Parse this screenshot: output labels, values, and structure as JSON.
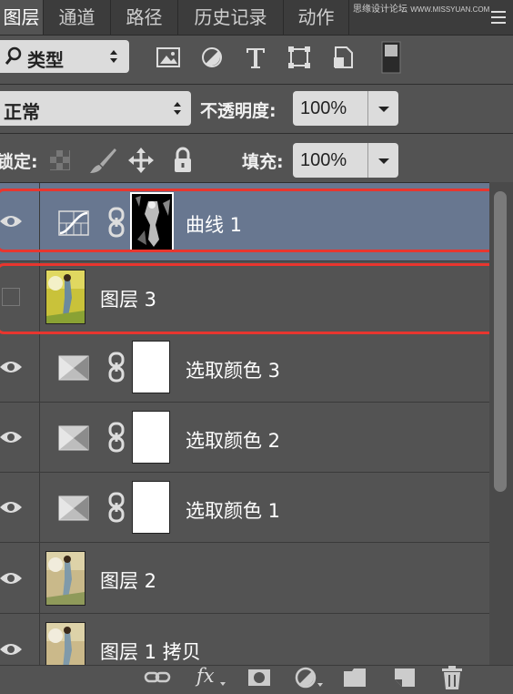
{
  "tabs": [
    {
      "label": "图层",
      "active": true
    },
    {
      "label": "通道",
      "active": false
    },
    {
      "label": "路径",
      "active": false
    },
    {
      "label": "历史记录",
      "active": false
    },
    {
      "label": "动作",
      "active": false
    }
  ],
  "watermark": {
    "line1": "思缘设计论坛",
    "line2": "WWW.MISSYUAN.COM"
  },
  "filter": {
    "label": "类型",
    "icons": [
      "image-filter-icon",
      "adjustment-filter-icon",
      "text-filter-icon",
      "shape-filter-icon",
      "smart-object-filter-icon"
    ]
  },
  "blend": {
    "mode": "正常",
    "opacity_label": "不透明度:",
    "opacity_value": "100%"
  },
  "lock": {
    "label": "锁定:",
    "fill_label": "填充:",
    "fill_value": "100%"
  },
  "layers": [
    {
      "name": "曲线 1",
      "type": "curves-adjustment",
      "visible": true,
      "selected": true
    },
    {
      "name": "图层 3",
      "type": "photo",
      "visible": false,
      "selected": false
    },
    {
      "name": "选取颜色 3",
      "type": "selective-color-adjustment",
      "visible": true,
      "selected": false
    },
    {
      "name": "选取颜色 2",
      "type": "selective-color-adjustment",
      "visible": true,
      "selected": false
    },
    {
      "name": "选取颜色 1",
      "type": "selective-color-adjustment",
      "visible": true,
      "selected": false
    },
    {
      "name": "图层 2",
      "type": "photo",
      "visible": true,
      "selected": false
    },
    {
      "name": "图层 1 拷贝",
      "type": "photo",
      "visible": true,
      "selected": false
    }
  ],
  "bottom_icons": [
    "link-layers-icon",
    "fx-icon",
    "add-mask-icon",
    "new-adjustment-icon",
    "new-group-icon",
    "new-layer-icon",
    "delete-icon"
  ],
  "fx_label": "fx",
  "colors": {
    "panel_bg": "#535353",
    "selected_row": "#687790",
    "highlight": "#e8362f"
  }
}
